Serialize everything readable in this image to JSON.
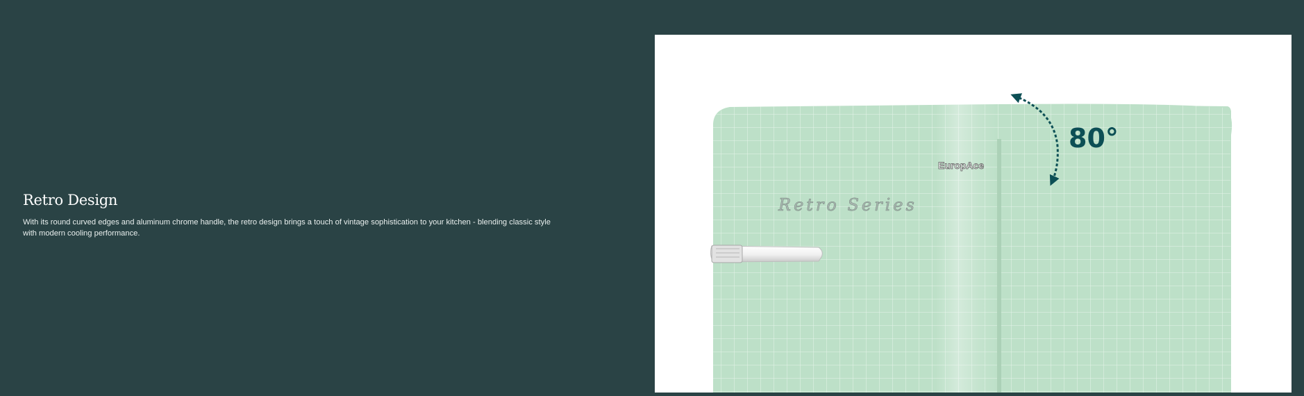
{
  "colors": {
    "background": "#2a4345",
    "title_text": "#ffffff",
    "body_text": "#e9efee",
    "image_panel": "#ffffff",
    "fridge_body": "#bde0c8",
    "fridge_door_seam": "#a8cfb5",
    "grid_line": "#e6f3ea",
    "arrow_accent": "#0c4f55"
  },
  "feature": {
    "title": "Retro Design",
    "description": "With its round curved edges and aluminum chrome handle, the retro design brings a touch of vintage sophistication to your kitchen - blending classic style with modern cooling performance."
  },
  "product_image": {
    "brand_badge": "EuropAce",
    "series_script": "Retro Series",
    "door_angle_label": "80°",
    "icons": [
      "curved-double-arrow-icon",
      "chrome-handle",
      "fridge-illustration"
    ]
  }
}
